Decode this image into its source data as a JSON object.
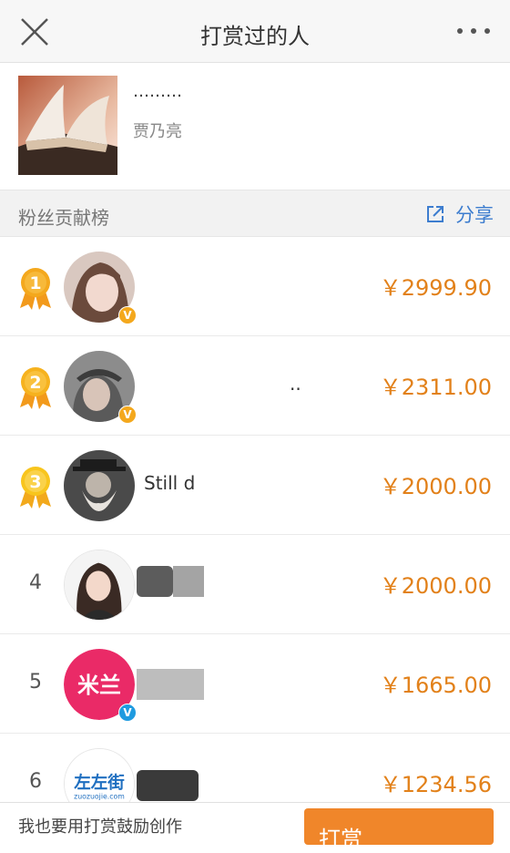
{
  "nav": {
    "title": "打赏过的人"
  },
  "article": {
    "title": "………",
    "author": "贾乃亮"
  },
  "section": {
    "title": "粉丝贡献榜",
    "share_label": "分享"
  },
  "colors": {
    "accent": "#e2811a",
    "link": "#3d7dcf",
    "badge_orange": "#f4a81d",
    "badge_blue": "#1f9be0",
    "cta": "#f0862a"
  },
  "ranking": [
    {
      "rank": "1",
      "name": "",
      "amount": "￥2999.90",
      "medal": true,
      "verified": "orange"
    },
    {
      "rank": "2",
      "name": "..",
      "amount": "￥2311.00",
      "medal": true,
      "verified": "orange"
    },
    {
      "rank": "3",
      "name": "Still d",
      "amount": "￥2000.00",
      "medal": true,
      "verified": "none"
    },
    {
      "rank": "4",
      "name": "",
      "amount": "￥2000.00",
      "medal": false,
      "verified": "none"
    },
    {
      "rank": "5",
      "name": "",
      "amount": "￥1665.00",
      "medal": false,
      "verified": "blue"
    },
    {
      "rank": "6",
      "name": "",
      "amount": "￥1234.56",
      "medal": false,
      "verified": "none"
    }
  ],
  "avatars": {
    "row5_text": "米兰",
    "row6_text": "左左街",
    "row6_sub": "zuozuojie.com"
  },
  "bottom": {
    "hint": "我也要用打赏鼓励创作",
    "button_label": "打赏"
  }
}
